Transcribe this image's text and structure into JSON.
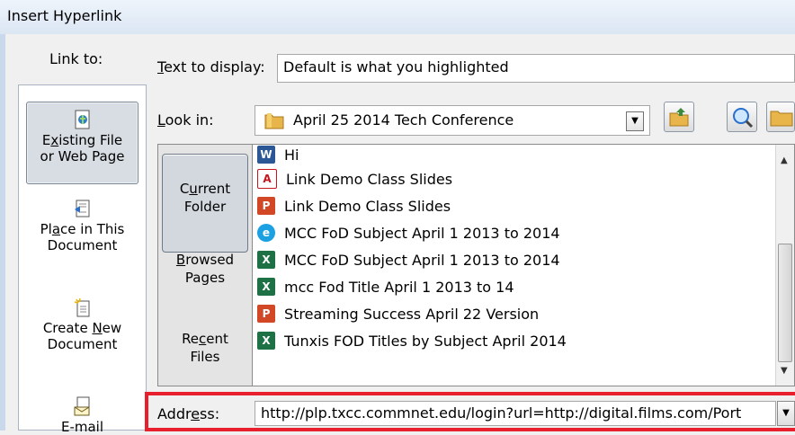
{
  "window": {
    "title": "Insert Hyperlink"
  },
  "link_to": {
    "label": "Link to:",
    "items": [
      {
        "line1": "Existing File",
        "line2": "or Web Page",
        "ul_char": "x",
        "selected": true,
        "icon": "globe-file-icon"
      },
      {
        "line1": "Place in This",
        "line2": "Document",
        "ul_char": "a",
        "selected": false,
        "icon": "document-place-icon"
      },
      {
        "line1": "Create New",
        "line2": "Document",
        "ul_char": "N",
        "selected": false,
        "icon": "new-document-icon"
      },
      {
        "line1": "E-mail",
        "line2": "",
        "ul_char": "",
        "selected": false,
        "icon": "email-icon"
      }
    ]
  },
  "text_to_display": {
    "label_pre": "",
    "label_ul": "T",
    "label_post": "ext to display:",
    "value": "Default is what you highlighted"
  },
  "look_in": {
    "label_ul": "L",
    "label_post": "ook in:",
    "value": "April 25 2014  Tech Conference"
  },
  "tabs": [
    {
      "pre": "C",
      "ul": "u",
      "post": "rrent",
      "line2": "Folder",
      "active": true
    },
    {
      "pre": "",
      "ul": "B",
      "post": "rowsed",
      "line2": "Pages",
      "active": false
    },
    {
      "pre": "Re",
      "ul": "c",
      "post": "ent",
      "line2": "Files",
      "active": false
    }
  ],
  "files": [
    {
      "name": "Hi",
      "type": "word"
    },
    {
      "name": "Link Demo Class Slides",
      "type": "pdf"
    },
    {
      "name": "Link Demo Class Slides",
      "type": "ppt"
    },
    {
      "name": "MCC FoD Subject April 1 2013 to 2014",
      "type": "ie"
    },
    {
      "name": "MCC FoD Subject April 1 2013 to 2014",
      "type": "excel"
    },
    {
      "name": "mcc Fod Title April 1 2013 to 14",
      "type": "excel"
    },
    {
      "name": "Streaming Success April 22 Version",
      "type": "ppt"
    },
    {
      "name": "Tunxis FOD Titles by Subject April 2014",
      "type": "excel"
    }
  ],
  "address": {
    "label_pre": "Addr",
    "label_ul": "e",
    "label_post": "ss:",
    "value": "http://plp.txcc.commnet.edu/login?url=http://digital.films.com/Port"
  },
  "colors": {
    "highlight": "#e8202e",
    "word": "#2b5797",
    "pdf": "#c4161c",
    "ppt": "#d24726",
    "excel": "#1e7145",
    "ie": "#1ba1e2"
  }
}
